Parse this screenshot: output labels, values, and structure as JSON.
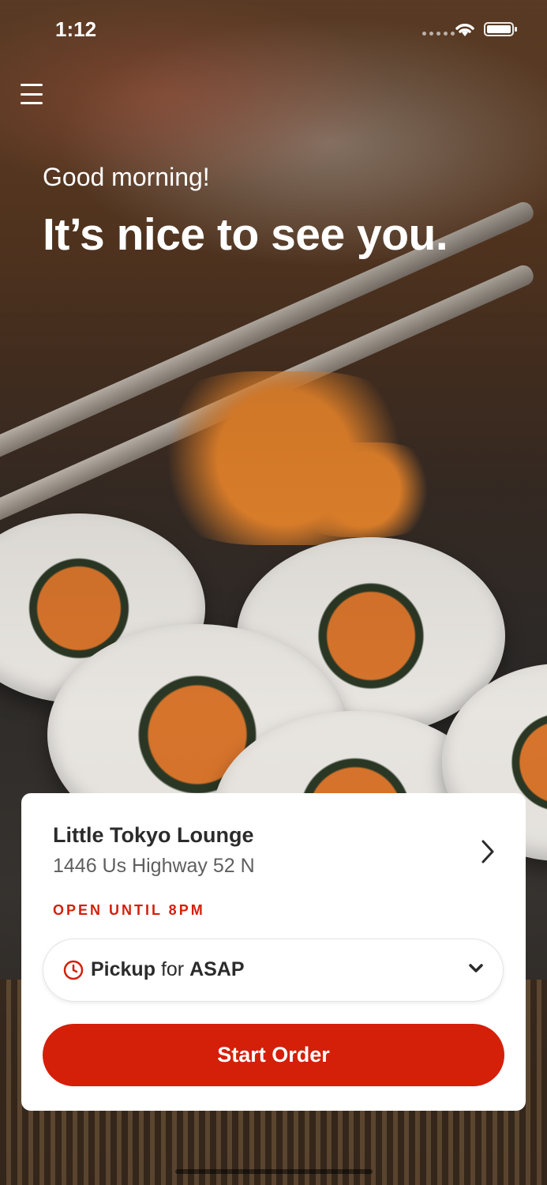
{
  "status_bar": {
    "time": "1:12"
  },
  "header": {
    "greeting": "Good morning!",
    "headline": "It’s nice to see you."
  },
  "location_card": {
    "name": "Little Tokyo Lounge",
    "address": "1446 Us Highway 52 N",
    "open_status": "OPEN UNTIL 8PM",
    "order_type": "Pickup",
    "connector": "for",
    "order_time": "ASAP",
    "start_button_label": "Start Order"
  },
  "icons": {
    "menu": "hamburger-menu-icon",
    "chevron": "chevron-right-icon",
    "clock": "clock-icon",
    "dropdown": "chevron-down-icon",
    "wifi": "wifi-icon",
    "battery": "battery-icon",
    "signal": "signal-icon"
  },
  "colors": {
    "accent": "#d41f09",
    "card_background": "#ffffff",
    "title_text": "#2b2b2b",
    "secondary_text": "#5f5f5f"
  }
}
